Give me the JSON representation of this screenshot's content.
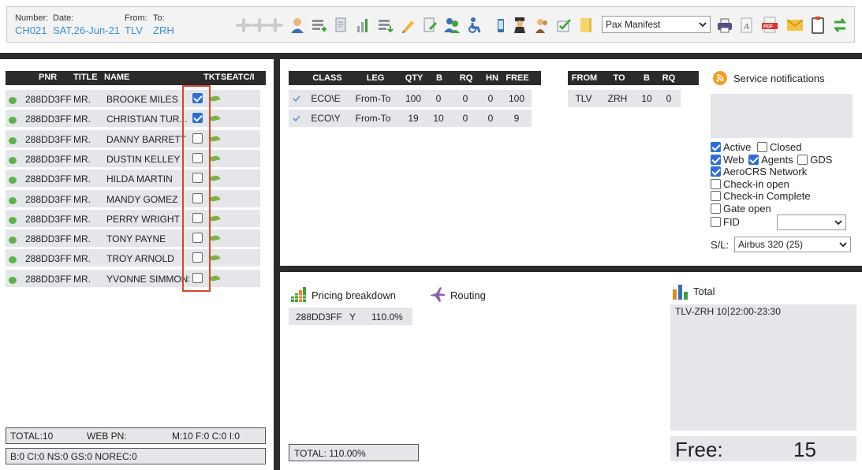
{
  "flight": {
    "number_label": "Number:",
    "number_value": "CH021",
    "date_label": "Date:",
    "date_value": "SAT,26-Jun-21",
    "from_label": "From:",
    "from_value": "TLV",
    "to_label": "To:",
    "to_value": "ZRH"
  },
  "toolbar": {
    "icons": [
      "plane-add-icon",
      "plane-add-icon",
      "plane-add-icon",
      "user-icon",
      "list-add-icon",
      "document-icon",
      "bar-chart-icon",
      "list-download-icon",
      "pencil-icon",
      "document-edit-icon",
      "users-icon",
      "wheelchair-user-icon",
      "mobile-icon",
      "pilot-icon",
      "crew-icon",
      "checkbox-mail-icon",
      "folder-note-icon"
    ],
    "report_select": "Pax Manifest",
    "right_icons": [
      "printer-icon",
      "text-document-icon",
      "pdf-icon",
      "envelope-icon",
      "clipboard-icon",
      "swap-arrows-icon"
    ]
  },
  "pax_table": {
    "headers": {
      "pnr": "PNR",
      "title": "TITLE",
      "name": "NAME",
      "tkt": "TKT",
      "seat": "SEATC/I"
    },
    "rows": [
      {
        "pnr": "288DD3FF",
        "title": "MR.",
        "name": "BROOKE MILES",
        "checked": true
      },
      {
        "pnr": "288DD3FF",
        "title": "MR.",
        "name": "CHRISTIAN TUR...",
        "checked": true
      },
      {
        "pnr": "288DD3FF",
        "title": "MR.",
        "name": "DANNY BARRETT",
        "checked": false
      },
      {
        "pnr": "288DD3FF",
        "title": "MR.",
        "name": "DUSTIN KELLEY",
        "checked": false
      },
      {
        "pnr": "288DD3FF",
        "title": "MR.",
        "name": "HILDA MARTIN",
        "checked": false
      },
      {
        "pnr": "288DD3FF",
        "title": "MR.",
        "name": "MANDY GOMEZ",
        "checked": false
      },
      {
        "pnr": "288DD3FF",
        "title": "MR.",
        "name": "PERRY WRIGHT",
        "checked": false
      },
      {
        "pnr": "288DD3FF",
        "title": "MR.",
        "name": "TONY PAYNE",
        "checked": false
      },
      {
        "pnr": "288DD3FF",
        "title": "MR.",
        "name": "TROY ARNOLD",
        "checked": false
      },
      {
        "pnr": "288DD3FF",
        "title": "MR.",
        "name": "YVONNE SIMMONS",
        "checked": false
      }
    ],
    "summary": {
      "total": "TOTAL:10",
      "web_pn": "WEB PN:",
      "breakdown": "M:10 F:0 C:0 I:0",
      "status": "B:0 CI:0 NS:0 GS:0 NOREC:0"
    }
  },
  "class_table": {
    "headers": [
      "CLASS",
      "LEG",
      "QTY",
      "B",
      "RQ",
      "HN",
      "FREE"
    ],
    "rows": [
      [
        "ECO\\E",
        "From-To",
        "100",
        "0",
        "0",
        "0",
        "100"
      ],
      [
        "ECO\\Y",
        "From-To",
        "19",
        "10",
        "0",
        "0",
        "9"
      ]
    ]
  },
  "leg_table": {
    "headers": [
      "FROM",
      "TO",
      "B",
      "RQ"
    ],
    "rows": [
      [
        "TLV",
        "ZRH",
        "10",
        "0"
      ]
    ]
  },
  "service": {
    "title": "Service notifications",
    "options": {
      "active": {
        "label": "Active",
        "checked": true
      },
      "closed": {
        "label": "Closed",
        "checked": false
      },
      "web": {
        "label": "Web",
        "checked": true
      },
      "agents": {
        "label": "Agents",
        "checked": true
      },
      "gds": {
        "label": "GDS",
        "checked": false
      },
      "aerocrs": {
        "label": "AeroCRS Network",
        "checked": true
      },
      "checkin_open": {
        "label": "Check-in open",
        "checked": false
      },
      "checkin_complete": {
        "label": "Check-in Complete",
        "checked": false
      },
      "gate_open": {
        "label": "Gate open",
        "checked": false
      },
      "fid": {
        "label": "FID",
        "checked": false
      }
    },
    "fid_select": "",
    "sl_label": "S/L:",
    "sl_select": "Airbus 320 (25)"
  },
  "pricing": {
    "title": "Pricing breakdown",
    "row": {
      "pnr": "288DD3FF",
      "class": "Y",
      "pct": "110.0%"
    },
    "total": "TOTAL:  110.00%"
  },
  "routing": {
    "title": "Routing"
  },
  "totals": {
    "title": "Total",
    "route": "TLV-ZRH",
    "count": "10",
    "time": "22:00-23:30",
    "free_label": "Free:",
    "free_value": "15"
  },
  "colors": {
    "accent": "#3a8fd1",
    "header_bg": "#2b2b2b",
    "row_bg": "#e4e6ea",
    "highlight": "#d9442c"
  }
}
